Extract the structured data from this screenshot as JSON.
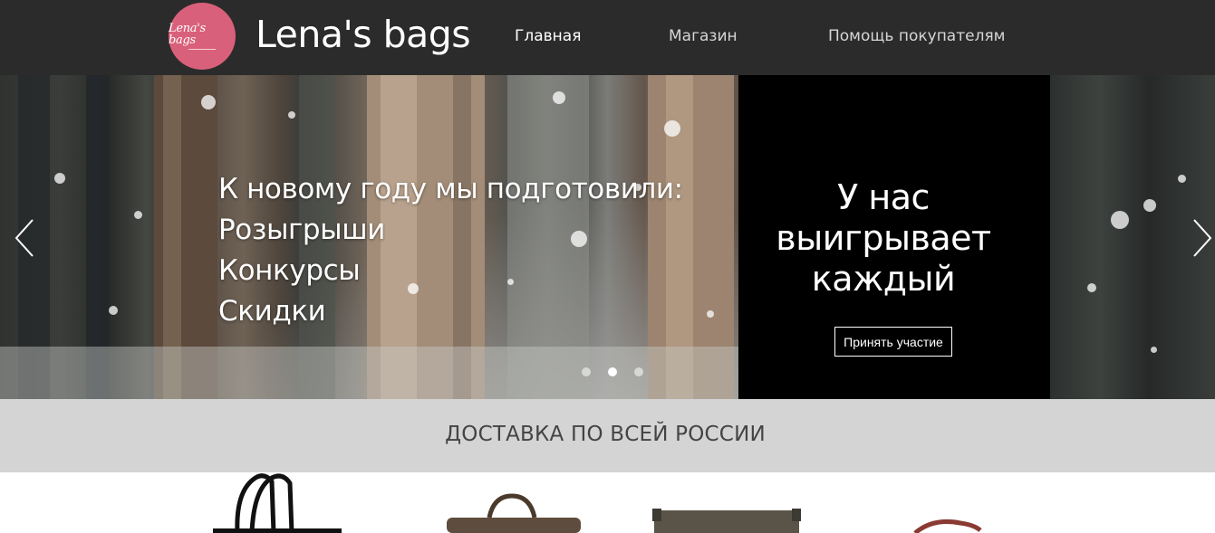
{
  "header": {
    "logo_text": "Lena's bags",
    "site_title": "Lena's bags",
    "nav": [
      {
        "label": "Главная",
        "active": true
      },
      {
        "label": "Магазин",
        "active": false
      },
      {
        "label": "Помощь покупателям",
        "active": false
      }
    ],
    "background": "#2b2b2b",
    "logo_color": "#d9607a"
  },
  "hero": {
    "lines": [
      "К новому году мы подготовили:",
      "Розыгрыши",
      "Конкурсы",
      "Скидки"
    ],
    "promo": {
      "title": "У нас выигрывает каждый",
      "button_label": "Принять участие"
    },
    "prev_icon": "chevron-left-icon",
    "next_icon": "chevron-right-icon",
    "slides_count": 3,
    "active_slide": 2
  },
  "delivery": {
    "text": "ДОСТАВКА ПО ВСЕЙ РОССИИ",
    "background": "#d4d4d4"
  },
  "products": [
    {
      "name": "product-black-leather-bag"
    },
    {
      "name": "product-brown-bag"
    },
    {
      "name": "product-olive-bag"
    },
    {
      "name": "product-red-strap-bag"
    }
  ]
}
